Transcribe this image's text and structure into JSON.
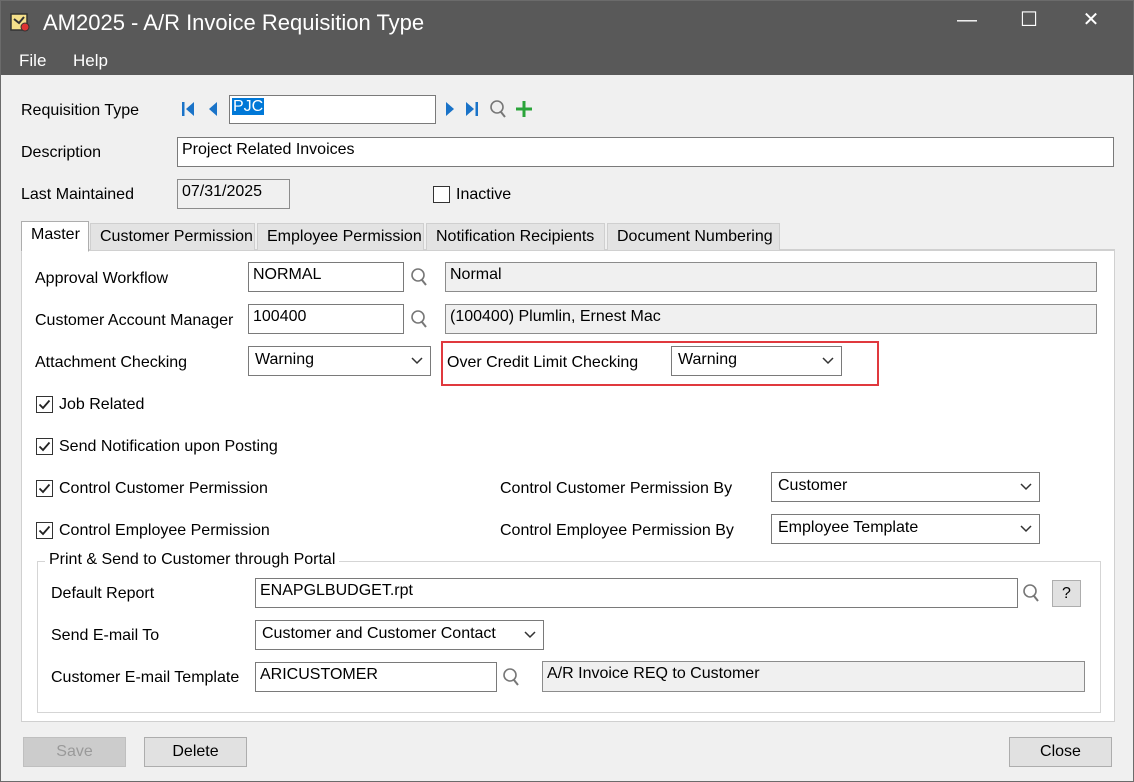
{
  "window": {
    "title": "AM2025 - A/R Invoice Requisition Type",
    "minimize": "—",
    "maximize": "☐",
    "close": "✕"
  },
  "menu": {
    "file": "File",
    "help": "Help"
  },
  "header": {
    "requisition_type_label": "Requisition Type",
    "requisition_type_value": "PJC",
    "description_label": "Description",
    "description_value": "Project Related Invoices",
    "last_maintained_label": "Last Maintained",
    "last_maintained_value": "07/31/2025",
    "inactive_label": "Inactive",
    "inactive_checked": false
  },
  "tabs": [
    {
      "label": "Master",
      "active": true
    },
    {
      "label": "Customer Permission",
      "active": false
    },
    {
      "label": "Employee Permission",
      "active": false
    },
    {
      "label": "Notification Recipients",
      "active": false
    },
    {
      "label": "Document Numbering",
      "active": false
    }
  ],
  "master": {
    "approval_workflow_label": "Approval Workflow",
    "approval_workflow_value": "NORMAL",
    "approval_workflow_desc": "Normal",
    "account_manager_label": "Customer Account Manager",
    "account_manager_value": "100400",
    "account_manager_desc": "(100400) Plumlin, Ernest Mac",
    "attachment_checking_label": "Attachment Checking",
    "attachment_checking_value": "Warning",
    "over_credit_label": "Over Credit Limit Checking",
    "over_credit_value": "Warning",
    "job_related_label": "Job Related",
    "send_notification_label": "Send Notification upon Posting",
    "control_customer_label": "Control Customer Permission",
    "control_employee_label": "Control Employee Permission",
    "control_customer_by_label": "Control Customer Permission By",
    "control_customer_by_value": "Customer",
    "control_employee_by_label": "Control Employee Permission By",
    "control_employee_by_value": "Employee Template"
  },
  "portal": {
    "group_title": "Print & Send to Customer through Portal",
    "default_report_label": "Default Report",
    "default_report_value": "ENAPGLBUDGET.rpt",
    "help_button": "?",
    "send_email_label": "Send E-mail To",
    "send_email_value": "Customer and Customer Contact",
    "email_template_label": "Customer E-mail Template",
    "email_template_value": "ARICUSTOMER",
    "email_template_desc": "A/R Invoice REQ to Customer"
  },
  "buttons": {
    "save": "Save",
    "delete": "Delete",
    "close": "Close"
  },
  "colors": {
    "titlebar": "#595959",
    "highlight": "#e0393e",
    "nav_blue": "#1a73c8",
    "add_green": "#2aa43a"
  }
}
